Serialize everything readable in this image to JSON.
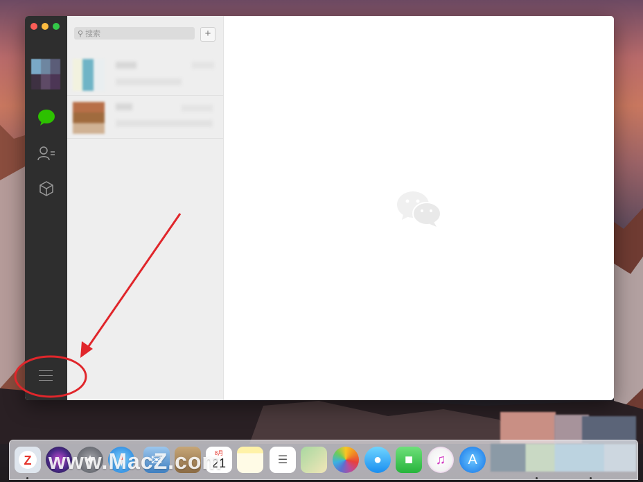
{
  "window": {
    "sidebar": {
      "icons": [
        "chat-bubble-icon",
        "contacts-icon",
        "cube-icon",
        "menu-icon"
      ],
      "active_color": "#2dc100"
    },
    "list": {
      "search_placeholder": "搜索",
      "add_label": "+"
    }
  },
  "dock": {
    "apps": [
      "zapp-icon",
      "siri-icon",
      "launchpad-icon",
      "safari-icon",
      "mail-icon",
      "contacts-app-icon",
      "calendar-icon",
      "notes-icon",
      "reminders-icon",
      "maps-icon",
      "photos-icon",
      "messages-icon",
      "facetime-icon",
      "itunes-icon",
      "appstore-icon"
    ],
    "calendar_day": "21",
    "calendar_month": "8月"
  },
  "watermark": "www.MacZ.com",
  "annotation_color": "#e0262b"
}
